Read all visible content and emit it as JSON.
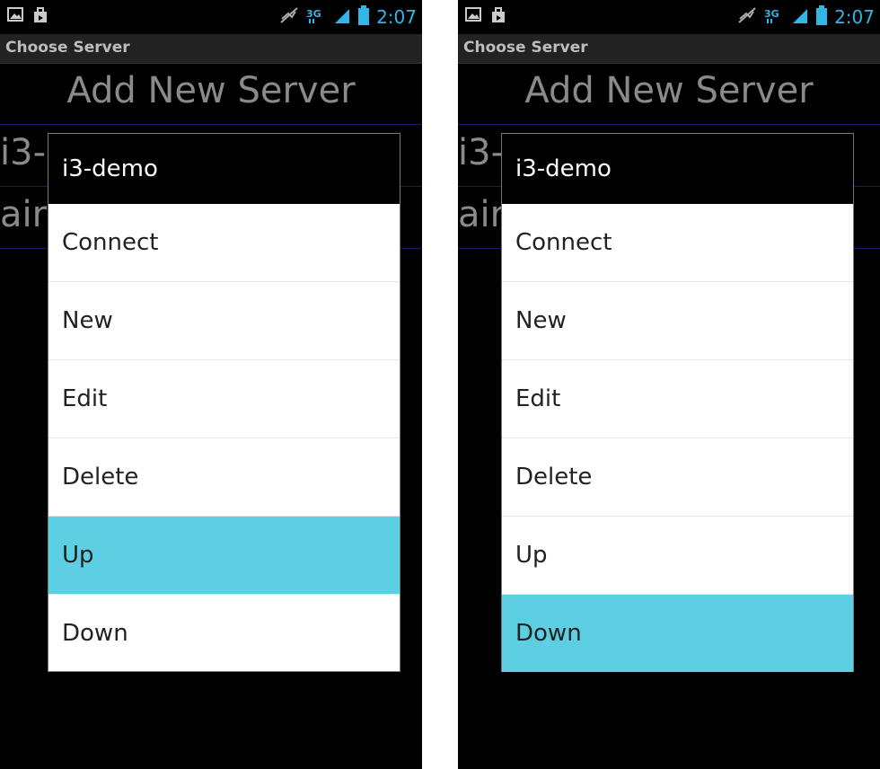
{
  "phones": [
    {
      "status": {
        "time": "2:07",
        "network": "3G"
      },
      "title": "Choose Server",
      "add_new": "Add New Server",
      "bg_rows": [
        "i3-demo",
        "air"
      ],
      "dialog": {
        "title": "i3-demo",
        "items": [
          {
            "label": "Connect",
            "selected": false
          },
          {
            "label": "New",
            "selected": false
          },
          {
            "label": "Edit",
            "selected": false
          },
          {
            "label": "Delete",
            "selected": false
          },
          {
            "label": "Up",
            "selected": true
          },
          {
            "label": "Down",
            "selected": false
          }
        ]
      }
    },
    {
      "status": {
        "time": "2:07",
        "network": "3G"
      },
      "title": "Choose Server",
      "add_new": "Add New Server",
      "bg_rows": [
        "i3-demo",
        "air"
      ],
      "dialog": {
        "title": "i3-demo",
        "items": [
          {
            "label": "Connect",
            "selected": false
          },
          {
            "label": "New",
            "selected": false
          },
          {
            "label": "Edit",
            "selected": false
          },
          {
            "label": "Delete",
            "selected": false
          },
          {
            "label": "Up",
            "selected": false
          },
          {
            "label": "Down",
            "selected": true
          }
        ]
      }
    }
  ],
  "colors": {
    "highlight": "#5ccfe3",
    "accent": "#33b5e5"
  }
}
